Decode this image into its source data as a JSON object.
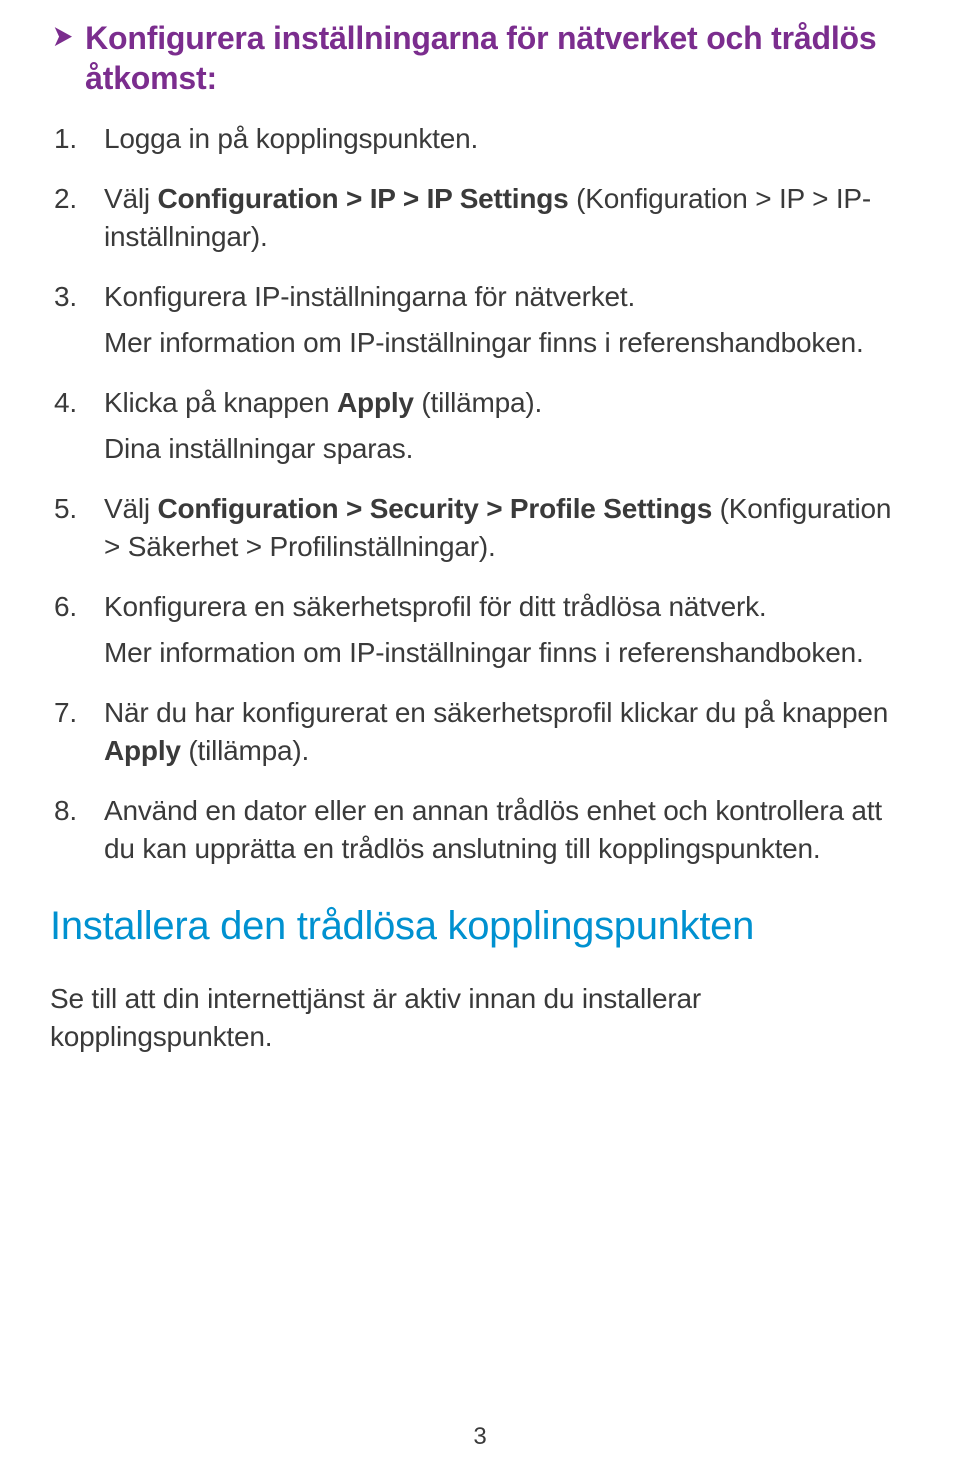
{
  "heading": "Konfigurera inställningarna för nätverket och trådlös åtkomst:",
  "steps": [
    {
      "text": "Logga in på kopplingspunkten."
    },
    {
      "pre": "Välj ",
      "bold": "Configuration > IP > IP Settings",
      "post": " (Konfiguration > IP > IP-inställningar)."
    },
    {
      "text": "Konfigurera IP-inställningarna för nätverket.",
      "sub": "Mer information om IP-inställningar finns i referenshandboken."
    },
    {
      "pre": "Klicka på knappen ",
      "bold": "Apply",
      "post": " (tillämpa).",
      "sub": "Dina inställningar sparas."
    },
    {
      "pre": "Välj ",
      "bold": "Configuration > Security > Profile Settings",
      "post": " (Konfiguration > Säkerhet > Profilinställningar)."
    },
    {
      "text": "Konfigurera en säkerhetsprofil för ditt trådlösa nätverk.",
      "sub": "Mer information om IP-inställningar finns i referenshandboken."
    },
    {
      "pre": "När du har konfigurerat en säkerhetsprofil klickar du på knappen ",
      "bold": "Apply",
      "post": " (tillämpa)."
    },
    {
      "text": "Använd en dator eller en annan trådlös enhet och kontrollera att du kan upprätta en trådlös anslutning till kopplingspunkten."
    }
  ],
  "section_title": "Installera den trådlösa kopplingspunkten",
  "section_para": "Se till att din internettjänst är aktiv innan du installerar kopplingspunkten.",
  "page_number": "3"
}
